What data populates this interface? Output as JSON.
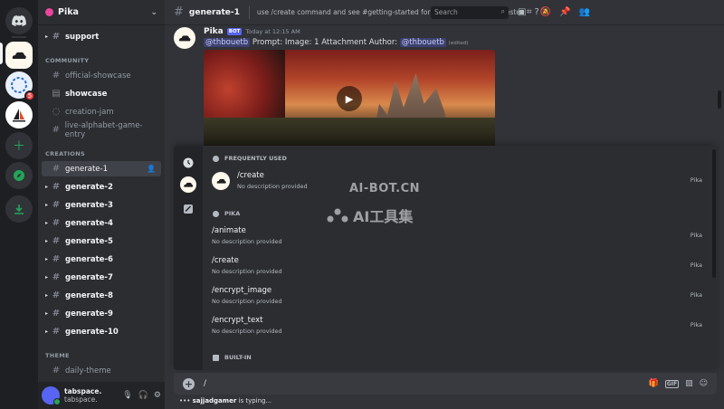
{
  "server_rail": {
    "servers": [
      {
        "icon": "discord-home-icon"
      },
      {
        "icon": "pika-server-icon",
        "active": true
      },
      {
        "icon": "spiral-server-icon",
        "badge": "5"
      },
      {
        "icon": "sailboat-server-icon"
      },
      {
        "icon": "add-server-icon"
      },
      {
        "icon": "explore-icon"
      },
      {
        "icon": "download-icon"
      }
    ]
  },
  "guild": {
    "name": "Pika"
  },
  "sidebar": {
    "top_channel": "support",
    "categories": {
      "community": "COMMUNITY",
      "creations": "CREATIONS",
      "theme": "THEME"
    },
    "community_channels": [
      "official-showcase",
      "showcase",
      "creation-jam",
      "live-alphabet-game-entry"
    ],
    "creations_channels": [
      "generate-1",
      "generate-2",
      "generate-3",
      "generate-4",
      "generate-5",
      "generate-6",
      "generate-7",
      "generate-8",
      "generate-9",
      "generate-10"
    ],
    "theme_channels": [
      "daily-theme"
    ]
  },
  "user": {
    "display_name": "tabspace.",
    "username": "tabspace."
  },
  "topbar": {
    "channel": "generate-1",
    "topic": "use /create command and see #getting-started for instructions and suggested ...",
    "search_placeholder": "Search"
  },
  "message": {
    "author": "Pika",
    "tag": "BOT",
    "timestamp": "Today at 12:15 AM",
    "mention1": "@thbouetb",
    "text": " Prompt:  Image: 1 Attachment  Author: ",
    "mention2": "@thbouetb",
    "edited": "(edited)"
  },
  "popup": {
    "frequently_used_label": "FREQUENTLY USED",
    "pika_label": "PIKA",
    "builtin_label": "BUILT-IN",
    "frequent": [
      {
        "name": "/create",
        "desc": "No description provided",
        "source": "Pika"
      }
    ],
    "commands": [
      {
        "name": "/animate",
        "desc": "No description provided",
        "source": "Pika"
      },
      {
        "name": "/create",
        "desc": "No description provided",
        "source": "Pika"
      },
      {
        "name": "/encrypt_image",
        "desc": "No description provided",
        "source": "Pika"
      },
      {
        "name": "/encrypt_text",
        "desc": "No description provided",
        "source": "Pika"
      }
    ]
  },
  "watermark": {
    "line1": "AI-BOT.CN",
    "line2": "AI工具集"
  },
  "composer": {
    "value": "/",
    "gif_label": "GIF"
  },
  "typing": {
    "user": "sajjadgamer",
    "suffix": " is typing..."
  }
}
